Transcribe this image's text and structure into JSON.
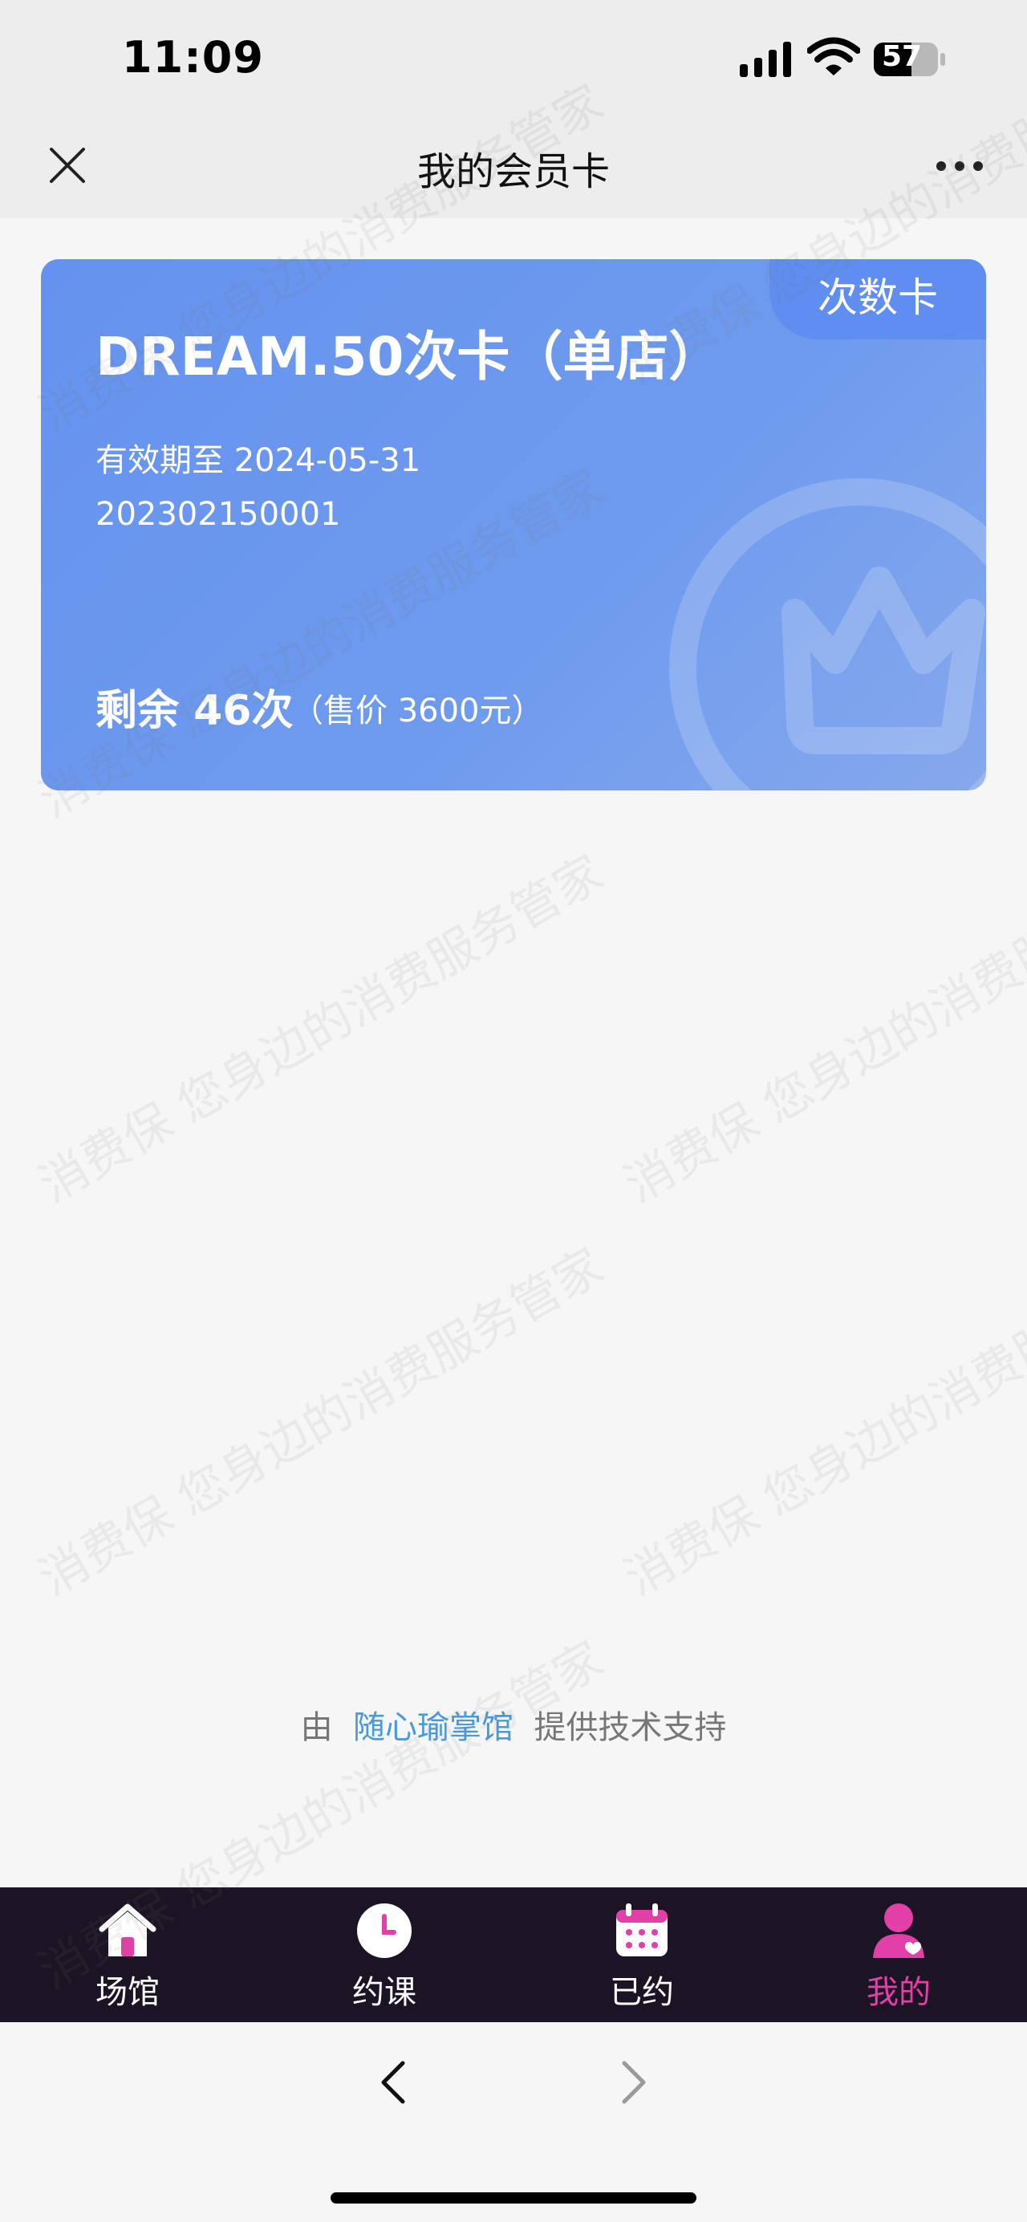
{
  "status_bar": {
    "time": "11:09",
    "battery": "57"
  },
  "nav": {
    "title": "我的会员卡"
  },
  "card": {
    "badge": "次数卡",
    "name": "DREAM.50次卡（单店）",
    "validity": "有效期至 2024-05-31",
    "number": "202302150001",
    "remaining": "剩余 46次",
    "price": "（售价 3600元）"
  },
  "credit": {
    "prefix": "由",
    "link": "随心瑜掌馆",
    "suffix": "提供技术支持"
  },
  "tabs": [
    {
      "label": "场馆",
      "icon": "home-icon",
      "active": false
    },
    {
      "label": "约课",
      "icon": "clock-icon",
      "active": false
    },
    {
      "label": "已约",
      "icon": "calendar-icon",
      "active": false
    },
    {
      "label": "我的",
      "icon": "user-icon",
      "active": true
    }
  ],
  "watermark": {
    "text": "消费保 您身边的消费服务管家"
  },
  "colors": {
    "card": "#6592ee",
    "tab_bar": "#1c1324",
    "active_tab": "#e23fa8",
    "link": "#4a9ad8"
  }
}
